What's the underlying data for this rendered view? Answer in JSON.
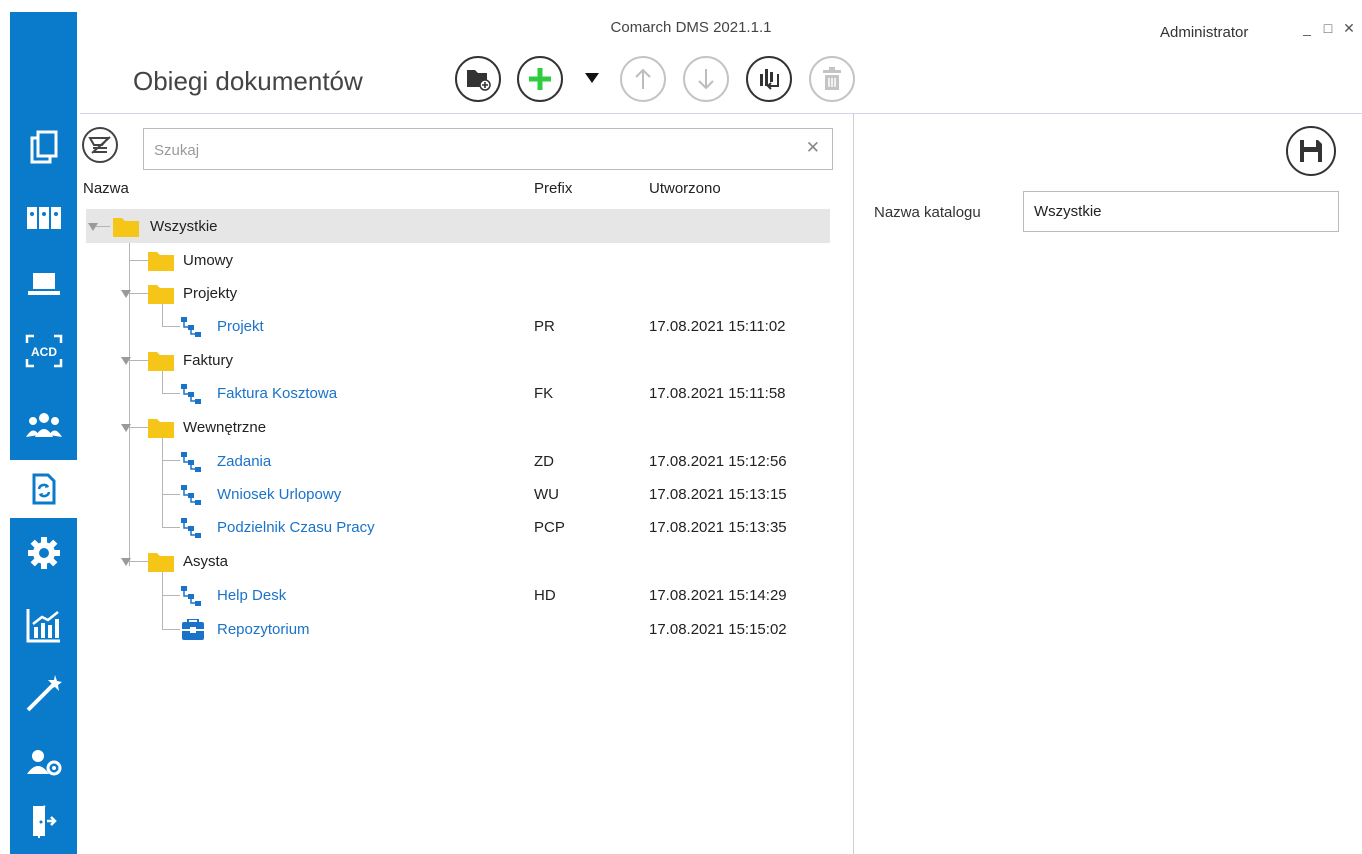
{
  "header": {
    "app_title": "Comarch DMS 2021.1.1",
    "user": "Administrator",
    "page_title": "Obiegi dokumentów",
    "window_controls": {
      "minimize": "_",
      "maximize": "□",
      "close": "✕"
    }
  },
  "sidebar": {
    "items": [
      {
        "icon": "documents-icon"
      },
      {
        "icon": "binders-icon"
      },
      {
        "icon": "laptop-icon"
      },
      {
        "icon": "acd-icon",
        "label": "ACD"
      },
      {
        "icon": "users-icon"
      },
      {
        "icon": "workflow-document-icon",
        "active": true
      },
      {
        "icon": "gear-icon"
      },
      {
        "icon": "reports-chart-icon"
      },
      {
        "icon": "magic-wand-icon"
      },
      {
        "icon": "user-settings-icon"
      },
      {
        "icon": "logout-door-icon"
      }
    ]
  },
  "toolbar": {
    "buttons": [
      {
        "icon": "folder-add-icon",
        "enabled": true
      },
      {
        "icon": "plus-icon",
        "enabled": true
      },
      {
        "icon": "arrow-up-icon",
        "enabled": false
      },
      {
        "icon": "arrow-down-icon",
        "enabled": false
      },
      {
        "icon": "sort-move-icon",
        "enabled": true
      },
      {
        "icon": "trash-icon",
        "enabled": false
      }
    ]
  },
  "search": {
    "placeholder": "Szukaj",
    "value": "",
    "clear": "✕"
  },
  "table": {
    "columns": [
      "Nazwa",
      "Prefix",
      "Utworzono"
    ],
    "rows": [
      {
        "name": "Wszystkie",
        "type": "folder",
        "prefix": "",
        "created": "",
        "selected": true
      },
      {
        "name": "Umowy",
        "type": "folder",
        "prefix": "",
        "created": ""
      },
      {
        "name": "Projekty",
        "type": "folder",
        "prefix": "",
        "created": ""
      },
      {
        "name": "Projekt",
        "type": "workflow",
        "prefix": "PR",
        "created": "17.08.2021 15:11:02"
      },
      {
        "name": "Faktury",
        "type": "folder",
        "prefix": "",
        "created": ""
      },
      {
        "name": "Faktura Kosztowa",
        "type": "workflow",
        "prefix": "FK",
        "created": "17.08.2021 15:11:58"
      },
      {
        "name": "Wewnętrzne",
        "type": "folder",
        "prefix": "",
        "created": ""
      },
      {
        "name": "Zadania",
        "type": "workflow",
        "prefix": "ZD",
        "created": "17.08.2021 15:12:56"
      },
      {
        "name": "Wniosek Urlopowy",
        "type": "workflow",
        "prefix": "WU",
        "created": "17.08.2021 15:13:15"
      },
      {
        "name": "Podzielnik Czasu Pracy",
        "type": "workflow",
        "prefix": "PCP",
        "created": "17.08.2021 15:13:35"
      },
      {
        "name": "Asysta",
        "type": "folder",
        "prefix": "",
        "created": ""
      },
      {
        "name": "Help Desk",
        "type": "workflow",
        "prefix": "HD",
        "created": "17.08.2021 15:14:29"
      },
      {
        "name": "Repozytorium",
        "type": "repository",
        "prefix": "",
        "created": "17.08.2021 15:15:02"
      }
    ]
  },
  "details": {
    "save_icon": "save-icon",
    "catalog_label": "Nazwa katalogu",
    "catalog_value": "Wszystkie"
  },
  "colors": {
    "sidebar": "#0a7acb",
    "link": "#1a73c9",
    "folder": "#f5c518",
    "plus": "#2ecc40",
    "selection": "#e6e6e6"
  }
}
